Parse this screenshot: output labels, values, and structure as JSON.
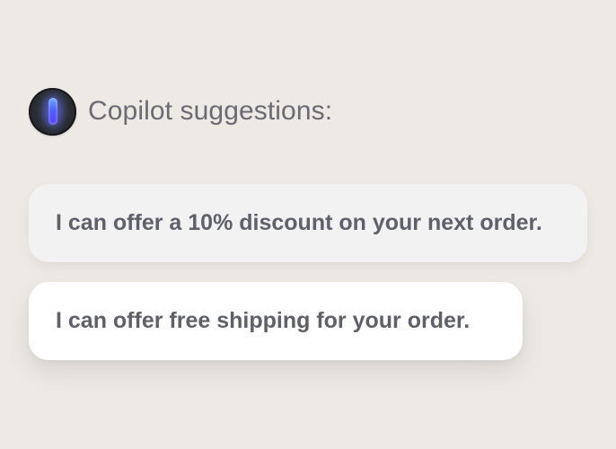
{
  "header": {
    "avatar_icon": "copilot-orb-icon",
    "title": "Copilot suggestions:"
  },
  "suggestions": [
    {
      "text": "I can offer a 10% discount on your next order."
    },
    {
      "text": "I can offer free shipping for your order."
    }
  ],
  "colors": {
    "background": "#edeae5",
    "accent_glow": "#5a63ff",
    "text": "#5f6069"
  }
}
